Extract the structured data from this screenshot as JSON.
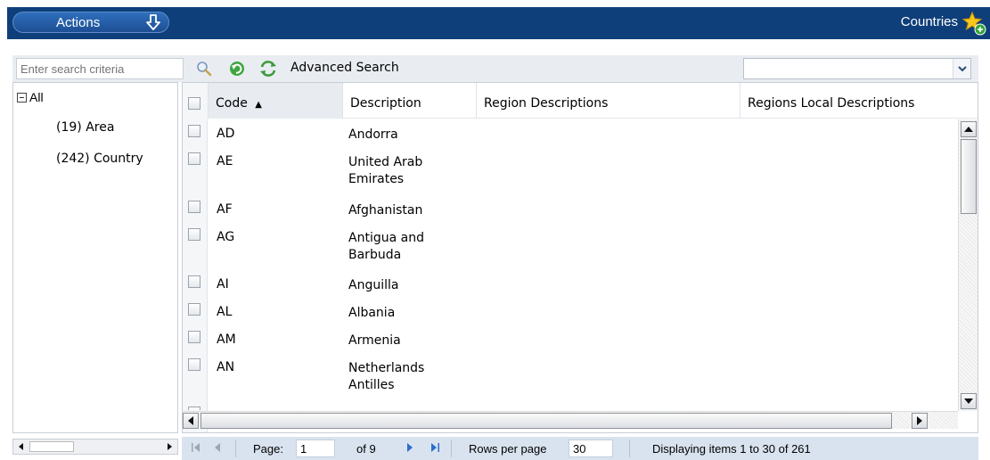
{
  "header": {
    "actions_label": "Actions",
    "title": "Countries"
  },
  "toolbar": {
    "search_placeholder": "Enter search criteria",
    "advanced_search_label": "Advanced Search",
    "filter_value": ""
  },
  "tree": {
    "root_label": "All",
    "nodes": [
      {
        "label": "(19) Area"
      },
      {
        "label": "(242) Country"
      }
    ]
  },
  "grid": {
    "columns": [
      "Code",
      "Description",
      "Region Descriptions",
      "Regions Local Descriptions"
    ],
    "sort_indicator": "▲",
    "rows": [
      {
        "code": "AD",
        "description": "Andorra"
      },
      {
        "code": "AE",
        "description": "United Arab Emirates"
      },
      {
        "code": "AF",
        "description": "Afghanistan"
      },
      {
        "code": "AG",
        "description": "Antigua and Barbuda"
      },
      {
        "code": "AI",
        "description": "Anguilla"
      },
      {
        "code": "AL",
        "description": "Albania"
      },
      {
        "code": "AM",
        "description": "Armenia"
      },
      {
        "code": "AN",
        "description": "Netherlands Antilles"
      }
    ]
  },
  "pager": {
    "page_label": "Page:",
    "page_value": "1",
    "of_label": "of 9",
    "rows_label": "Rows per page",
    "rows_value": "30",
    "display_text": "Displaying items 1 to 30 of 261"
  },
  "colors": {
    "header_bg": "#0f3f7a",
    "toolbar_bg": "#e9edf2",
    "pager_bg": "#d9e3ef"
  },
  "icons": [
    "down-arrow-icon",
    "star-add-icon",
    "search-icon",
    "clear-icon",
    "refresh-icon",
    "chevron-down-icon",
    "first-page-icon",
    "prev-page-icon",
    "next-page-icon",
    "last-page-icon"
  ]
}
